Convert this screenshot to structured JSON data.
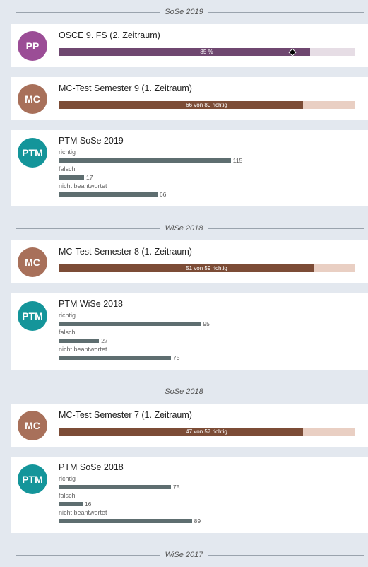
{
  "colors": {
    "pp": "#9b4d96",
    "mc": "#a8705a",
    "ptm": "#14959a",
    "pp_fill": "#6f4770",
    "pp_track": "#e6dde5",
    "mc_fill": "#7c4c36",
    "mc_track": "#e9cfc3",
    "ptm_bar": "#5e6e70"
  },
  "feed": [
    {
      "kind": "sep",
      "label": "SoSe 2019"
    },
    {
      "kind": "bar",
      "avatar": "PP",
      "avatar_color": "pp",
      "title": "OSCE 9. FS (2. Zeitraum)",
      "bar_text": "85 %",
      "fraction": 0.85,
      "fill_color": "pp_fill",
      "track_color": "pp_track",
      "marker": 0.79
    },
    {
      "kind": "bar",
      "avatar": "MC",
      "avatar_color": "mc",
      "title": "MC-Test Semester 9 (1. Zeitraum)",
      "bar_text": "66 von 80 richtig",
      "fraction": 0.825,
      "fill_color": "mc_fill",
      "track_color": "mc_track"
    },
    {
      "kind": "ptm",
      "avatar": "PTM",
      "avatar_color": "ptm",
      "title": "PTM SoSe 2019",
      "rows": [
        {
          "label": "richtig",
          "value": 115
        },
        {
          "label": "falsch",
          "value": 17
        },
        {
          "label": "nicht beantwortet",
          "value": 66
        }
      ]
    },
    {
      "kind": "sep",
      "label": "WiSe 2018"
    },
    {
      "kind": "bar",
      "avatar": "MC",
      "avatar_color": "mc",
      "title": "MC-Test Semester 8 (1. Zeitraum)",
      "bar_text": "51 von 59 richtig",
      "fraction": 0.864,
      "fill_color": "mc_fill",
      "track_color": "mc_track"
    },
    {
      "kind": "ptm",
      "avatar": "PTM",
      "avatar_color": "ptm",
      "title": "PTM WiSe 2018",
      "rows": [
        {
          "label": "richtig",
          "value": 95
        },
        {
          "label": "falsch",
          "value": 27
        },
        {
          "label": "nicht beantwortet",
          "value": 75
        }
      ]
    },
    {
      "kind": "sep",
      "label": "SoSe 2018"
    },
    {
      "kind": "bar",
      "avatar": "MC",
      "avatar_color": "mc",
      "title": "MC-Test Semester 7 (1. Zeitraum)",
      "bar_text": "47 von 57 richtig",
      "fraction": 0.825,
      "fill_color": "mc_fill",
      "track_color": "mc_track"
    },
    {
      "kind": "ptm",
      "avatar": "PTM",
      "avatar_color": "ptm",
      "title": "PTM SoSe 2018",
      "rows": [
        {
          "label": "richtig",
          "value": 75
        },
        {
          "label": "falsch",
          "value": 16
        },
        {
          "label": "nicht beantwortet",
          "value": 89
        }
      ]
    },
    {
      "kind": "sep",
      "label": "WiSe 2017"
    }
  ]
}
